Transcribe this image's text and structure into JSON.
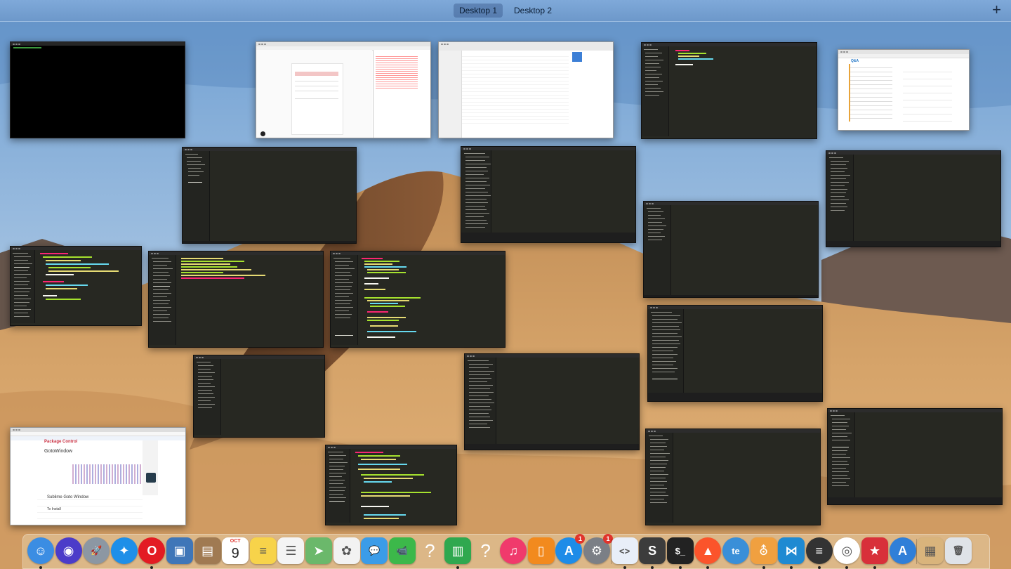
{
  "spaces": {
    "tabs": [
      {
        "label": "Desktop 1",
        "active": true
      },
      {
        "label": "Desktop 2",
        "active": false
      }
    ],
    "add_label": "+"
  },
  "windows": {
    "package_control": {
      "brand": "Package Control",
      "package_name": "GotoWindow",
      "readme_heading": "Sublime Goto Window",
      "install_heading": "To Install"
    },
    "qa": {
      "brand": "Q&A"
    }
  },
  "dock": {
    "items": [
      {
        "name": "finder",
        "color": "#3b8de3",
        "glyph": "☺",
        "running": true
      },
      {
        "name": "siri",
        "color": "#4b3cc9",
        "glyph": "◉",
        "running": false
      },
      {
        "name": "launchpad",
        "color": "#8c97a3",
        "glyph": "🚀",
        "running": false
      },
      {
        "name": "safari",
        "color": "#1e8fe8",
        "glyph": "✦",
        "running": false
      },
      {
        "name": "opera",
        "color": "#e31b23",
        "glyph": "O",
        "running": true
      },
      {
        "name": "preview",
        "color": "#3f76b8",
        "glyph": "▣",
        "running": false
      },
      {
        "name": "contacts",
        "color": "#a07a52",
        "glyph": "▤",
        "running": false
      },
      {
        "name": "calendar",
        "color": "#ffffff",
        "glyph": "9",
        "month": "OCT",
        "running": false
      },
      {
        "name": "notes",
        "color": "#f7d34a",
        "glyph": "≡",
        "running": false
      },
      {
        "name": "reminders",
        "color": "#f4f4f4",
        "glyph": "☰",
        "running": false
      },
      {
        "name": "maps",
        "color": "#6bb86b",
        "glyph": "➤",
        "running": false
      },
      {
        "name": "photos",
        "color": "#f2f2f2",
        "glyph": "✿",
        "running": false
      },
      {
        "name": "messages",
        "color": "#3b9ce8",
        "glyph": "💬",
        "running": false
      },
      {
        "name": "facetime",
        "color": "#3cb84a",
        "glyph": "📹",
        "running": false
      },
      {
        "name": "unknown-app-1",
        "color": "transparent",
        "glyph": "?",
        "running": false
      },
      {
        "name": "numbers",
        "color": "#2fa84f",
        "glyph": "▥",
        "running": true
      },
      {
        "name": "unknown-app-2",
        "color": "transparent",
        "glyph": "?",
        "running": false
      },
      {
        "name": "itunes",
        "color": "#f03a6c",
        "glyph": "♫",
        "running": false
      },
      {
        "name": "books",
        "color": "#f28a1e",
        "glyph": "▯",
        "running": false
      },
      {
        "name": "app-store",
        "color": "#1e8ce8",
        "glyph": "A",
        "badge": "1",
        "running": false
      },
      {
        "name": "system-preferences",
        "color": "#7b7f86",
        "glyph": "⚙",
        "badge": "1",
        "running": false
      },
      {
        "name": "xcode-like",
        "color": "#e8eef8",
        "glyph": "<>",
        "running": true
      },
      {
        "name": "sublime-text",
        "color": "#3c3c3c",
        "glyph": "S",
        "running": true
      },
      {
        "name": "terminal",
        "color": "#222222",
        "glyph": "$_",
        "running": true
      },
      {
        "name": "brave",
        "color": "#fb542b",
        "glyph": "▲",
        "running": true
      },
      {
        "name": "te-app",
        "color": "#3a8fd8",
        "glyph": "te",
        "running": false
      },
      {
        "name": "sequel-pro",
        "color": "#f0a040",
        "glyph": "⛢",
        "running": true
      },
      {
        "name": "vscode",
        "color": "#1f8ad2",
        "glyph": "⋈",
        "running": true
      },
      {
        "name": "menu-app",
        "color": "#333333",
        "glyph": "≡",
        "running": true
      },
      {
        "name": "chrome",
        "color": "#ffffff",
        "glyph": "◎",
        "running": true
      },
      {
        "name": "bookmark-app",
        "color": "#d8303a",
        "glyph": "★",
        "running": true
      },
      {
        "name": "app-store-utility",
        "color": "#2f7fd8",
        "glyph": "A",
        "running": false
      },
      {
        "name": "archive-utility",
        "color": "#d9b47c",
        "glyph": "▦",
        "running": false
      },
      {
        "name": "trash",
        "color": "#dfe3e8",
        "glyph": "🗑",
        "running": false
      }
    ]
  }
}
